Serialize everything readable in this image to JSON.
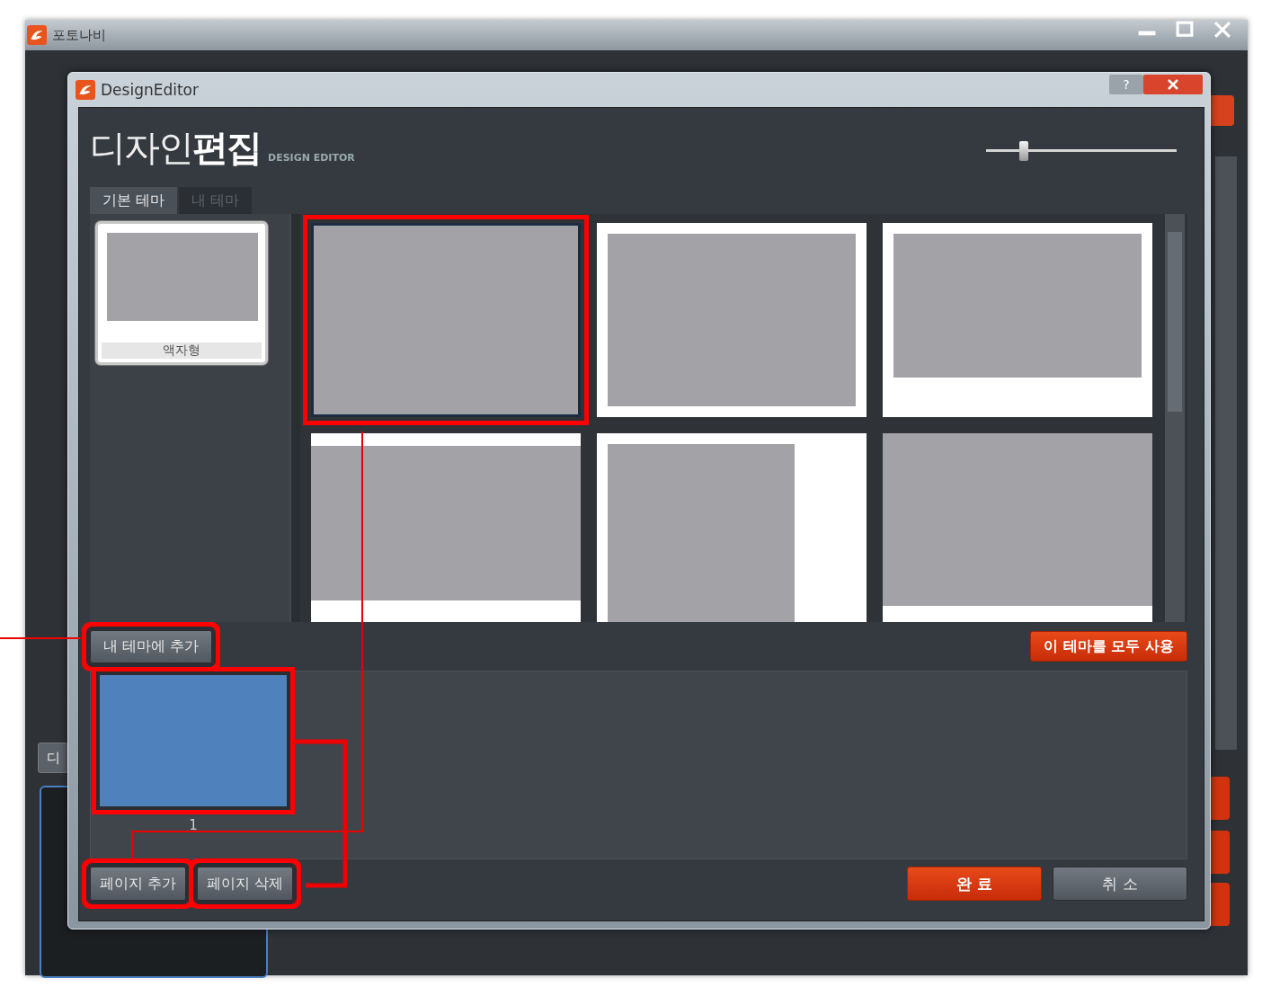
{
  "app_window": {
    "title": "포토나비",
    "side_button": "디"
  },
  "dialog": {
    "title": "DesignEditor",
    "help_button": "?",
    "heading_light": "디자인",
    "heading_bold": "편집",
    "subtitle": "DESIGN EDITOR",
    "zoom_slider": {
      "level": 0.2
    }
  },
  "tabs": [
    {
      "label": "기본 테마",
      "selected": true
    },
    {
      "label": "내 테마",
      "selected": false
    }
  ],
  "themes": [
    {
      "label": "액자형",
      "selected": true
    }
  ],
  "templates": [
    {
      "kind": "full",
      "selected": true,
      "highlighted": true
    },
    {
      "kind": "inset",
      "selected": false,
      "highlighted": false
    },
    {
      "kind": "polaroid",
      "selected": false,
      "highlighted": false
    },
    {
      "kind": "bottom-strip",
      "selected": false,
      "highlighted": false
    },
    {
      "kind": "left-block",
      "selected": false,
      "highlighted": false
    },
    {
      "kind": "thin-strip",
      "selected": false,
      "highlighted": false
    }
  ],
  "add_to_my_theme_button": {
    "label": "내 테마에 추가",
    "highlighted": true
  },
  "use_all_button": {
    "label": "이 테마를 모두 사용"
  },
  "pages": [
    {
      "number": "1",
      "highlighted": true
    }
  ],
  "add_page_button": {
    "label": "페이지 추가",
    "highlighted": true
  },
  "delete_page_button": {
    "label": "페이지 삭제",
    "highlighted": true
  },
  "ok_button": {
    "label": "완 료"
  },
  "cancel_button": {
    "label": "취 소"
  }
}
